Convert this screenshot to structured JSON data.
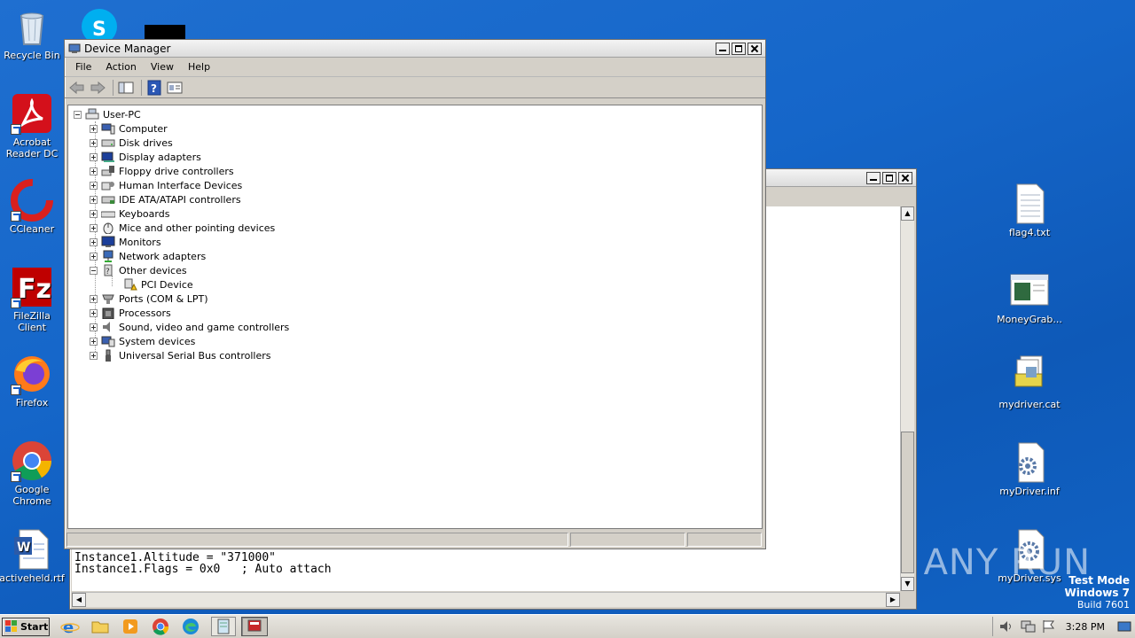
{
  "desktop_icons": [
    {
      "label": "Recycle Bin",
      "icon": "recycle-bin-icon"
    },
    {
      "label": "Acrobat Reader DC",
      "icon": "acrobat-icon"
    },
    {
      "label": "CCleaner",
      "icon": "ccleaner-icon"
    },
    {
      "label": "FileZilla Client",
      "icon": "filezilla-icon"
    },
    {
      "label": "Firefox",
      "icon": "firefox-icon"
    },
    {
      "label": "Google Chrome",
      "icon": "chrome-icon"
    },
    {
      "label": "activeheld.rtf",
      "icon": "word-document-icon"
    },
    {
      "label": "flag4.txt",
      "icon": "text-file-icon"
    },
    {
      "label": "MoneyGrab...",
      "icon": "application-icon"
    },
    {
      "label": "mydriver.cat",
      "icon": "catalog-file-icon"
    },
    {
      "label": "myDriver.inf",
      "icon": "settings-file-icon"
    },
    {
      "label": "myDriver.sys",
      "icon": "system-file-icon"
    }
  ],
  "device_manager": {
    "title": "Device Manager",
    "menu": [
      "File",
      "Action",
      "View",
      "Help"
    ],
    "toolbar": [
      "back-arrow-icon",
      "forward-arrow-icon",
      "show-hide-tree-icon",
      "help-icon",
      "properties-icon"
    ],
    "root": "User-PC",
    "nodes": [
      {
        "label": "Computer",
        "icon": "computer-icon",
        "expanded": false
      },
      {
        "label": "Disk drives",
        "icon": "disk-drive-icon",
        "expanded": false
      },
      {
        "label": "Display adapters",
        "icon": "display-adapter-icon",
        "expanded": false
      },
      {
        "label": "Floppy drive controllers",
        "icon": "floppy-controller-icon",
        "expanded": false
      },
      {
        "label": "Human Interface Devices",
        "icon": "hid-icon",
        "expanded": false
      },
      {
        "label": "IDE ATA/ATAPI controllers",
        "icon": "ide-controller-icon",
        "expanded": false
      },
      {
        "label": "Keyboards",
        "icon": "keyboard-icon",
        "expanded": false
      },
      {
        "label": "Mice and other pointing devices",
        "icon": "mouse-icon",
        "expanded": false
      },
      {
        "label": "Monitors",
        "icon": "monitor-icon",
        "expanded": false
      },
      {
        "label": "Network adapters",
        "icon": "network-adapter-icon",
        "expanded": false
      },
      {
        "label": "Other devices",
        "icon": "unknown-device-icon",
        "expanded": true
      },
      {
        "label": "PCI Device",
        "icon": "warning-device-icon",
        "child": true
      },
      {
        "label": "Ports (COM & LPT)",
        "icon": "port-icon",
        "expanded": false
      },
      {
        "label": "Processors",
        "icon": "processor-icon",
        "expanded": false
      },
      {
        "label": "Sound, video and game controllers",
        "icon": "sound-icon",
        "expanded": false
      },
      {
        "label": "System devices",
        "icon": "system-devices-icon",
        "expanded": false
      },
      {
        "label": "Universal Serial Bus controllers",
        "icon": "usb-icon",
        "expanded": false
      }
    ]
  },
  "notepad": {
    "lines": [
      "Instance1.Altitude = \"371000\"",
      "Instance1.Flags = 0x0   ; Auto attach"
    ]
  },
  "taskbar": {
    "start_label": "Start",
    "clock": "3:28 PM",
    "apps": [
      "internet-explorer-icon",
      "file-explorer-icon",
      "media-player-icon",
      "chrome-icon",
      "edge-icon",
      "notepad-icon",
      "device-manager-icon"
    ]
  },
  "watermark": {
    "brand": "ANY RUN",
    "line1": "Test Mode",
    "line2": "Windows 7",
    "line3": "Build 7601"
  }
}
